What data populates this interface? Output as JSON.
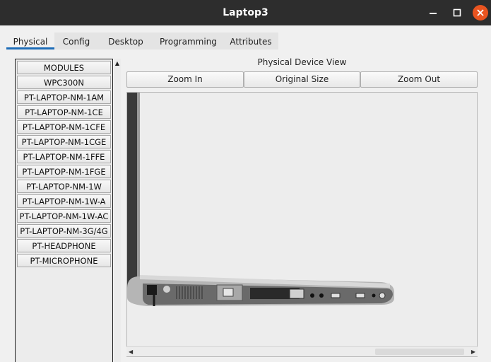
{
  "window": {
    "title": "Laptop3",
    "colors": {
      "titlebar": "#2d2d2d",
      "close": "#e95420",
      "active_tab_underline": "#1e6db7"
    }
  },
  "tabs": [
    {
      "label": "Physical",
      "active": true
    },
    {
      "label": "Config",
      "active": false
    },
    {
      "label": "Desktop",
      "active": false
    },
    {
      "label": "Programming",
      "active": false
    },
    {
      "label": "Attributes",
      "active": false
    }
  ],
  "modules": {
    "items": [
      {
        "label": "MODULES"
      },
      {
        "label": "WPC300N"
      },
      {
        "label": "PT-LAPTOP-NM-1AM"
      },
      {
        "label": "PT-LAPTOP-NM-1CE"
      },
      {
        "label": "PT-LAPTOP-NM-1CFE"
      },
      {
        "label": "PT-LAPTOP-NM-1CGE"
      },
      {
        "label": "PT-LAPTOP-NM-1FFE"
      },
      {
        "label": "PT-LAPTOP-NM-1FGE"
      },
      {
        "label": "PT-LAPTOP-NM-1W"
      },
      {
        "label": "PT-LAPTOP-NM-1W-A"
      },
      {
        "label": "PT-LAPTOP-NM-1W-AC"
      },
      {
        "label": "PT-LAPTOP-NM-3G/4G"
      },
      {
        "label": "PT-HEADPHONE"
      },
      {
        "label": "PT-MICROPHONE"
      }
    ]
  },
  "physical_view": {
    "title": "Physical Device View",
    "zoom_in_label": "Zoom In",
    "original_size_label": "Original Size",
    "zoom_out_label": "Zoom Out"
  },
  "icons": {
    "minimize": "minimize-icon",
    "maximize": "maximize-icon",
    "close": "close-icon",
    "scroll_up": "arrow-up-icon",
    "scroll_left": "arrow-left-icon",
    "scroll_right": "arrow-right-icon"
  }
}
